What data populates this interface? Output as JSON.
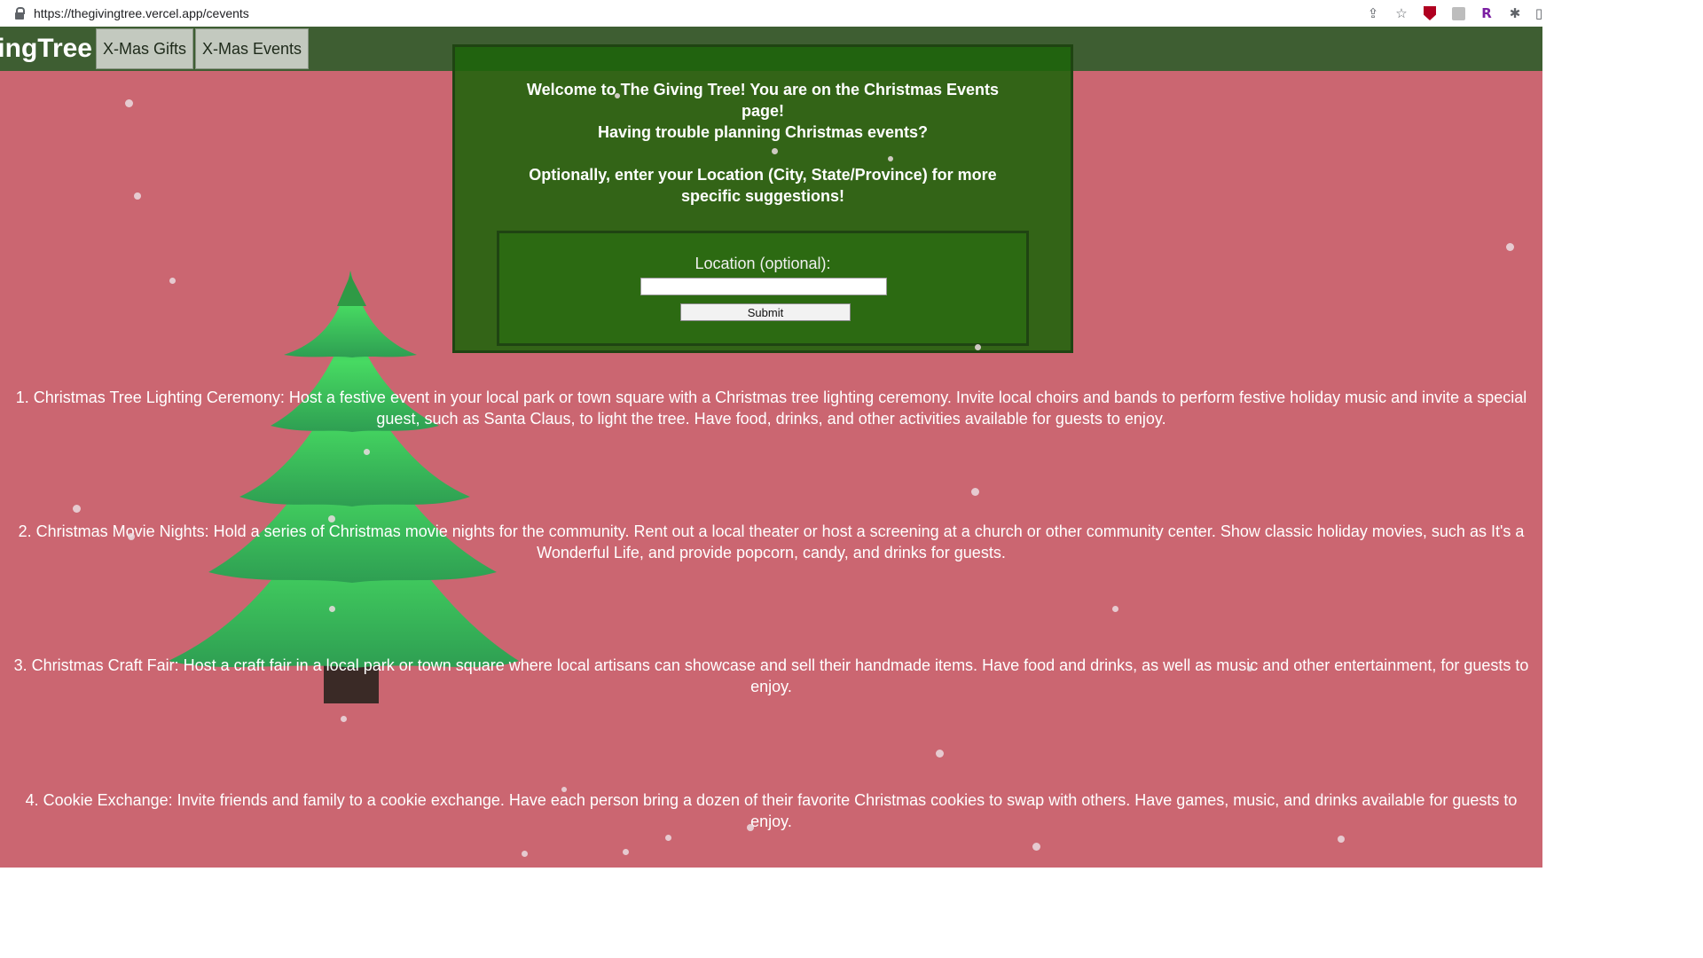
{
  "browser": {
    "url": "https://thegivingtree.vercel.app/cevents",
    "icons": [
      "share-icon",
      "star-icon",
      "ublock-icon",
      "extension-icon",
      "r-extension-icon",
      "puzzle-icon",
      "sidebar-icon"
    ],
    "ext_r_label": "R"
  },
  "nav": {
    "brand": "ingTree",
    "gifts_label": "X-Mas Gifts",
    "events_label": "X-Mas Events"
  },
  "welcome": {
    "line1": "Welcome to The Giving Tree! You are on the Christmas Events page!",
    "line2": "Having trouble planning Christmas events?",
    "line3": "Optionally, enter your Location (City, State/Province) for more specific suggestions!",
    "location_label": "Location (optional):",
    "location_value": "",
    "submit_label": "Submit"
  },
  "events": [
    "1. Christmas Tree Lighting Ceremony: Host a festive event in your local park or town square with a Christmas tree lighting ceremony. Invite local choirs and bands to perform festive holiday music and invite a special guest, such as Santa Claus, to light the tree. Have food, drinks, and other activities available for guests to enjoy.",
    "2. Christmas Movie Nights: Hold a series of Christmas movie nights for the community. Rent out a local theater or host a screening at a church or other community center. Show classic holiday movies, such as It's a Wonderful Life, and provide popcorn, candy, and drinks for guests.",
    "3. Christmas Craft Fair: Host a craft fair in a local park or town square where local artisans can showcase and sell their handmade items. Have food and drinks, as well as music and other entertainment, for guests to enjoy.",
    "4. Cookie Exchange: Invite friends and family to a cookie exchange. Have each person bring a dozen of their favorite Christmas cookies to swap with others. Have games, music, and drinks available for guests to enjoy."
  ],
  "colors": {
    "page_background": "#cb6671",
    "navbar": "#3e5e32",
    "welcome_box": "#1e640a",
    "tree_green": "#3cc85a",
    "trunk": "#3a2a26"
  }
}
